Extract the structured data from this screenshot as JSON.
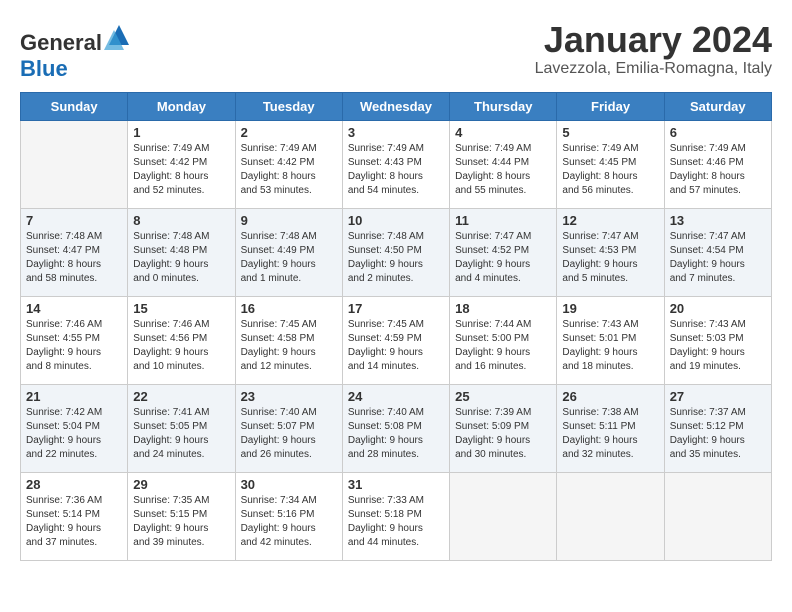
{
  "header": {
    "logo_general": "General",
    "logo_blue": "Blue",
    "title": "January 2024",
    "subtitle": "Lavezzola, Emilia-Romagna, Italy"
  },
  "days_of_week": [
    "Sunday",
    "Monday",
    "Tuesday",
    "Wednesday",
    "Thursday",
    "Friday",
    "Saturday"
  ],
  "weeks": [
    [
      {
        "day": "",
        "info": ""
      },
      {
        "day": "1",
        "info": "Sunrise: 7:49 AM\nSunset: 4:42 PM\nDaylight: 8 hours\nand 52 minutes."
      },
      {
        "day": "2",
        "info": "Sunrise: 7:49 AM\nSunset: 4:42 PM\nDaylight: 8 hours\nand 53 minutes."
      },
      {
        "day": "3",
        "info": "Sunrise: 7:49 AM\nSunset: 4:43 PM\nDaylight: 8 hours\nand 54 minutes."
      },
      {
        "day": "4",
        "info": "Sunrise: 7:49 AM\nSunset: 4:44 PM\nDaylight: 8 hours\nand 55 minutes."
      },
      {
        "day": "5",
        "info": "Sunrise: 7:49 AM\nSunset: 4:45 PM\nDaylight: 8 hours\nand 56 minutes."
      },
      {
        "day": "6",
        "info": "Sunrise: 7:49 AM\nSunset: 4:46 PM\nDaylight: 8 hours\nand 57 minutes."
      }
    ],
    [
      {
        "day": "7",
        "info": "Sunrise: 7:48 AM\nSunset: 4:47 PM\nDaylight: 8 hours\nand 58 minutes."
      },
      {
        "day": "8",
        "info": "Sunrise: 7:48 AM\nSunset: 4:48 PM\nDaylight: 9 hours\nand 0 minutes."
      },
      {
        "day": "9",
        "info": "Sunrise: 7:48 AM\nSunset: 4:49 PM\nDaylight: 9 hours\nand 1 minute."
      },
      {
        "day": "10",
        "info": "Sunrise: 7:48 AM\nSunset: 4:50 PM\nDaylight: 9 hours\nand 2 minutes."
      },
      {
        "day": "11",
        "info": "Sunrise: 7:47 AM\nSunset: 4:52 PM\nDaylight: 9 hours\nand 4 minutes."
      },
      {
        "day": "12",
        "info": "Sunrise: 7:47 AM\nSunset: 4:53 PM\nDaylight: 9 hours\nand 5 minutes."
      },
      {
        "day": "13",
        "info": "Sunrise: 7:47 AM\nSunset: 4:54 PM\nDaylight: 9 hours\nand 7 minutes."
      }
    ],
    [
      {
        "day": "14",
        "info": "Sunrise: 7:46 AM\nSunset: 4:55 PM\nDaylight: 9 hours\nand 8 minutes."
      },
      {
        "day": "15",
        "info": "Sunrise: 7:46 AM\nSunset: 4:56 PM\nDaylight: 9 hours\nand 10 minutes."
      },
      {
        "day": "16",
        "info": "Sunrise: 7:45 AM\nSunset: 4:58 PM\nDaylight: 9 hours\nand 12 minutes."
      },
      {
        "day": "17",
        "info": "Sunrise: 7:45 AM\nSunset: 4:59 PM\nDaylight: 9 hours\nand 14 minutes."
      },
      {
        "day": "18",
        "info": "Sunrise: 7:44 AM\nSunset: 5:00 PM\nDaylight: 9 hours\nand 16 minutes."
      },
      {
        "day": "19",
        "info": "Sunrise: 7:43 AM\nSunset: 5:01 PM\nDaylight: 9 hours\nand 18 minutes."
      },
      {
        "day": "20",
        "info": "Sunrise: 7:43 AM\nSunset: 5:03 PM\nDaylight: 9 hours\nand 19 minutes."
      }
    ],
    [
      {
        "day": "21",
        "info": "Sunrise: 7:42 AM\nSunset: 5:04 PM\nDaylight: 9 hours\nand 22 minutes."
      },
      {
        "day": "22",
        "info": "Sunrise: 7:41 AM\nSunset: 5:05 PM\nDaylight: 9 hours\nand 24 minutes."
      },
      {
        "day": "23",
        "info": "Sunrise: 7:40 AM\nSunset: 5:07 PM\nDaylight: 9 hours\nand 26 minutes."
      },
      {
        "day": "24",
        "info": "Sunrise: 7:40 AM\nSunset: 5:08 PM\nDaylight: 9 hours\nand 28 minutes."
      },
      {
        "day": "25",
        "info": "Sunrise: 7:39 AM\nSunset: 5:09 PM\nDaylight: 9 hours\nand 30 minutes."
      },
      {
        "day": "26",
        "info": "Sunrise: 7:38 AM\nSunset: 5:11 PM\nDaylight: 9 hours\nand 32 minutes."
      },
      {
        "day": "27",
        "info": "Sunrise: 7:37 AM\nSunset: 5:12 PM\nDaylight: 9 hours\nand 35 minutes."
      }
    ],
    [
      {
        "day": "28",
        "info": "Sunrise: 7:36 AM\nSunset: 5:14 PM\nDaylight: 9 hours\nand 37 minutes."
      },
      {
        "day": "29",
        "info": "Sunrise: 7:35 AM\nSunset: 5:15 PM\nDaylight: 9 hours\nand 39 minutes."
      },
      {
        "day": "30",
        "info": "Sunrise: 7:34 AM\nSunset: 5:16 PM\nDaylight: 9 hours\nand 42 minutes."
      },
      {
        "day": "31",
        "info": "Sunrise: 7:33 AM\nSunset: 5:18 PM\nDaylight: 9 hours\nand 44 minutes."
      },
      {
        "day": "",
        "info": ""
      },
      {
        "day": "",
        "info": ""
      },
      {
        "day": "",
        "info": ""
      }
    ]
  ]
}
